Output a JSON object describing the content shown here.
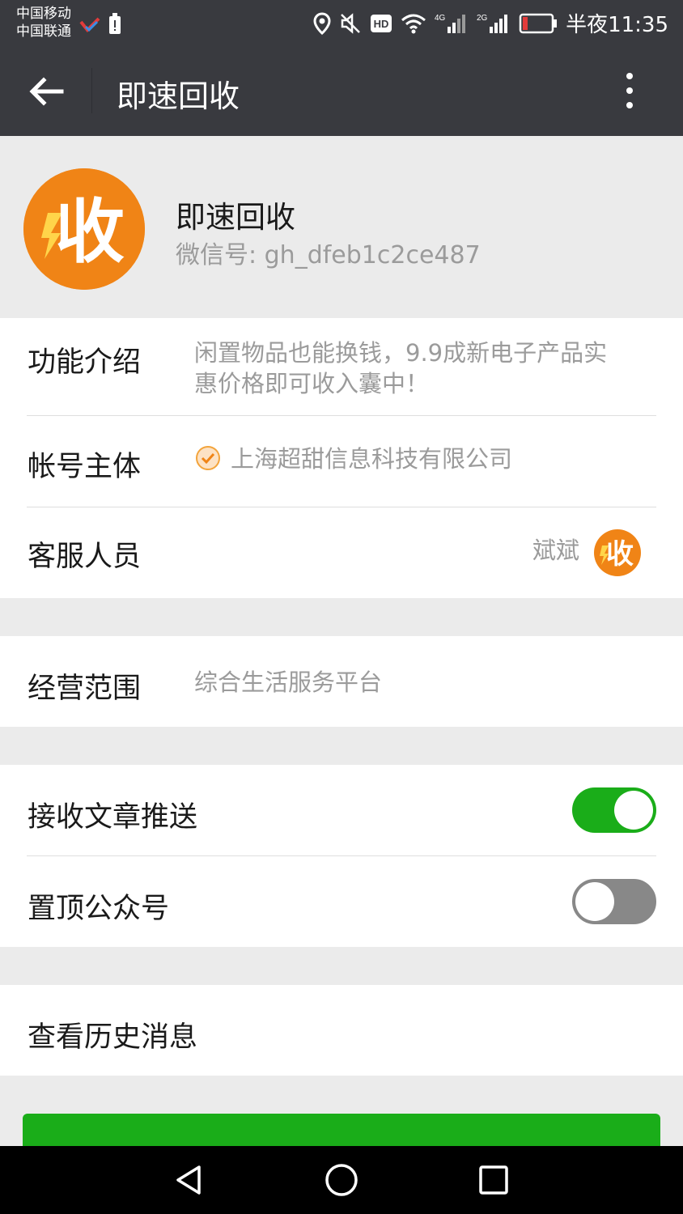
{
  "status_bar": {
    "carrier_1": "中国移动",
    "carrier_2": "中国联通",
    "time": "半夜11:35",
    "network_1": "4G",
    "network_2": "2G",
    "hd_badge": "HD"
  },
  "title_bar": {
    "title": "即速回收",
    "back_icon": "back-arrow-icon",
    "more_icon": "more-vertical-icon"
  },
  "profile": {
    "name": "即速回收",
    "wechat_id": "微信号: gh_dfeb1c2ce487",
    "avatar_glyph": "收",
    "avatar_color": "#f08416"
  },
  "info": {
    "intro_label": "功能介绍",
    "intro_value_line1": "闲置物品也能换钱，9.9成新电子产品实",
    "intro_value_line2": "惠价格即可收入囊中！",
    "account_label": "帐号主体",
    "account_value": "上海超甜信息科技有限公司",
    "service_label": "客服人员",
    "service_value": "斌斌",
    "service_avatar_glyph": "收"
  },
  "scope": {
    "label": "经营范围",
    "value": "综合生活服务平台"
  },
  "settings": {
    "receive_label": "接收文章推送",
    "receive_on": true,
    "pin_label": "置顶公众号",
    "pin_on": false
  },
  "history": {
    "label": "查看历史消息"
  },
  "colors": {
    "accent_green": "#1aad19",
    "orange": "#f08416",
    "header_bg": "#393a3f"
  }
}
